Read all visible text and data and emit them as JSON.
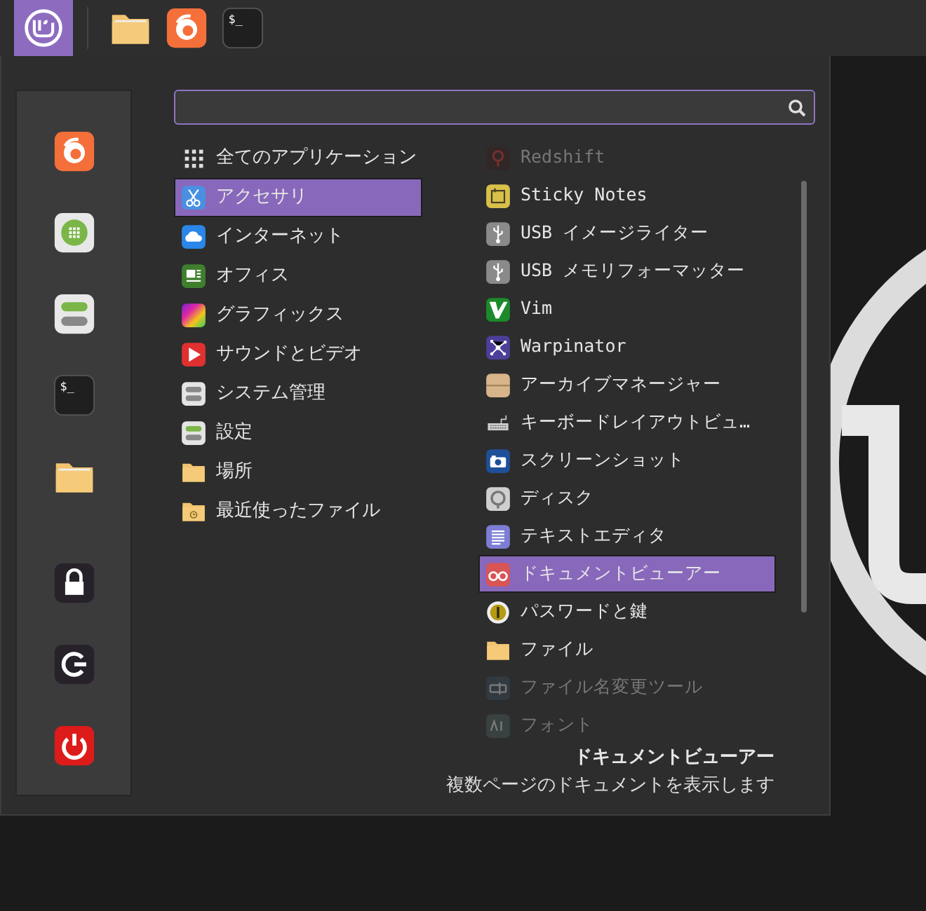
{
  "panel": {
    "launchers": [
      {
        "kind": "menu"
      },
      {
        "kind": "folder"
      },
      {
        "kind": "browser"
      },
      {
        "kind": "terminal",
        "glyph": "$_"
      }
    ]
  },
  "sidebar": {
    "favorites": [
      {
        "kind": "browser"
      },
      {
        "kind": "grid"
      },
      {
        "kind": "toggles"
      },
      {
        "kind": "terminal",
        "glyph": "$_"
      },
      {
        "kind": "folder"
      },
      {
        "kind": "lock"
      },
      {
        "kind": "logout"
      },
      {
        "kind": "power"
      }
    ]
  },
  "categories": [
    {
      "label": "全てのアプリケーション",
      "selected": false
    },
    {
      "label": "アクセサリ",
      "selected": true
    },
    {
      "label": "インターネット",
      "selected": false
    },
    {
      "label": "オフィス",
      "selected": false
    },
    {
      "label": "グラフィックス",
      "selected": false
    },
    {
      "label": "サウンドとビデオ",
      "selected": false
    },
    {
      "label": "システム管理",
      "selected": false
    },
    {
      "label": "設定",
      "selected": false
    },
    {
      "label": "場所",
      "selected": false
    },
    {
      "label": "最近使ったファイル",
      "selected": false
    }
  ],
  "applications": [
    {
      "label": "Redshift",
      "selected": false,
      "faded": true
    },
    {
      "label": "Sticky Notes",
      "selected": false,
      "faded": false
    },
    {
      "label": "USB イメージライター",
      "selected": false,
      "faded": false
    },
    {
      "label": "USB メモリフォーマッター",
      "selected": false,
      "faded": false
    },
    {
      "label": "Vim",
      "selected": false,
      "faded": false
    },
    {
      "label": "Warpinator",
      "selected": false,
      "faded": false
    },
    {
      "label": "アーカイブマネージャー",
      "selected": false,
      "faded": false
    },
    {
      "label": "キーボードレイアウトビュ…",
      "selected": false,
      "faded": false
    },
    {
      "label": "スクリーンショット",
      "selected": false,
      "faded": false
    },
    {
      "label": "ディスク",
      "selected": false,
      "faded": false
    },
    {
      "label": "テキストエディタ",
      "selected": false,
      "faded": false
    },
    {
      "label": "ドキュメントビューアー",
      "selected": true,
      "faded": false
    },
    {
      "label": "パスワードと鍵",
      "selected": false,
      "faded": false
    },
    {
      "label": "ファイル",
      "selected": false,
      "faded": false
    },
    {
      "label": "ファイル名変更ツール",
      "selected": false,
      "faded": true
    },
    {
      "label": "フォント",
      "selected": false,
      "faded": true
    }
  ],
  "description": {
    "title": "ドキュメントビューアー",
    "text": "複数ページのドキュメントを表示します"
  }
}
